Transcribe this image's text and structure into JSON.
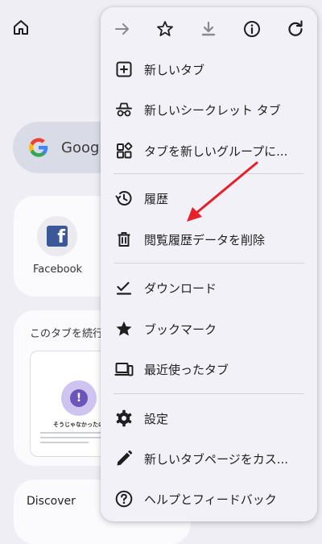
{
  "background": {
    "search_text": "Google",
    "shortcut_label": "Facebook",
    "tabs_card_title": "このタブを続行",
    "tab_thumb_heading": "そうじゃなかったの？",
    "discover_title": "Discover"
  },
  "menu": {
    "top_icons": [
      "forward-icon",
      "star-icon",
      "download-icon",
      "info-icon",
      "refresh-icon"
    ],
    "items": [
      {
        "icon": "new-tab-icon",
        "label": "新しいタブ"
      },
      {
        "icon": "incognito-icon",
        "label": "新しいシークレット タブ"
      },
      {
        "icon": "tab-group-icon",
        "label": "タブを新しいグループに..."
      },
      {
        "icon": "history-icon",
        "label": "履歴"
      },
      {
        "icon": "trash-icon",
        "label": "閲覧履歴データを削除"
      },
      {
        "icon": "downloads-icon",
        "label": "ダウンロード"
      },
      {
        "icon": "bookmark-star-icon",
        "label": "ブックマーク"
      },
      {
        "icon": "recent-tabs-icon",
        "label": "最近使ったタブ"
      },
      {
        "icon": "settings-gear-icon",
        "label": "設定"
      },
      {
        "icon": "pencil-icon",
        "label": "新しいタブページをカス..."
      },
      {
        "icon": "help-icon",
        "label": "ヘルプとフィードバック"
      }
    ]
  },
  "colors": {
    "menu_bg": "#f2f1f7",
    "annotation_arrow": "#e8202a",
    "icon_color": "#1f1f1f",
    "disabled_icon": "#8a8a8e"
  }
}
